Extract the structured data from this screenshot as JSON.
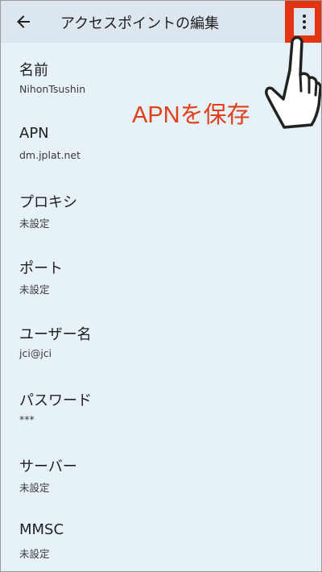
{
  "appbar": {
    "back_icon": "arrow-left-icon",
    "title": "アクセスポイントの編集",
    "menu_icon": "more-vert-icon",
    "highlight_color": "#e53412"
  },
  "annotation": {
    "text": "APNを保存",
    "color": "#e2401b",
    "pointer_icon": "pointing-hand-icon"
  },
  "settings": [
    {
      "label": "名前",
      "value": "NihonTsushin"
    },
    {
      "label": "APN",
      "value": "dm.jplat.net"
    },
    {
      "label": "プロキシ",
      "value": "未設定"
    },
    {
      "label": "ポート",
      "value": "未設定"
    },
    {
      "label": "ユーザー名",
      "value": "jci@jci"
    },
    {
      "label": "パスワード",
      "value": "***"
    },
    {
      "label": "サーバー",
      "value": "未設定"
    },
    {
      "label": "MMSC",
      "value": "未設定"
    }
  ]
}
